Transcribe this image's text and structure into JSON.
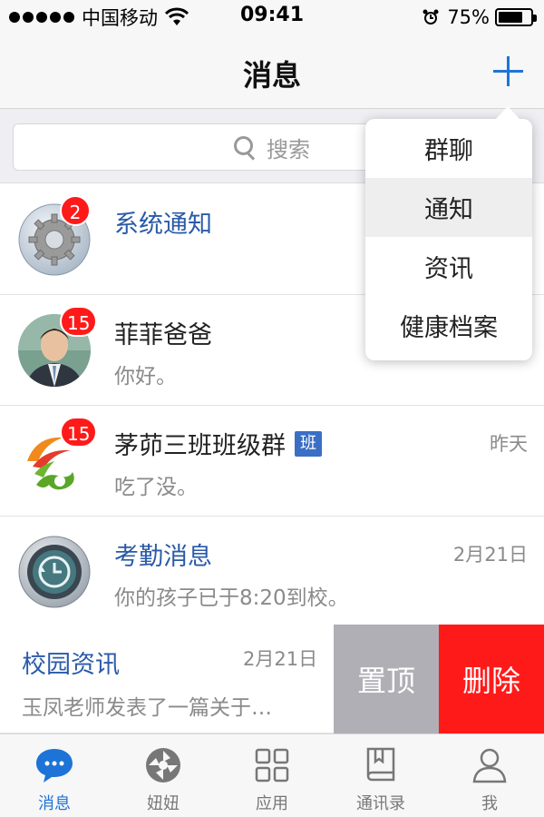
{
  "status_bar": {
    "carrier": "中国移动",
    "time": "09:41",
    "battery_percent": "75%",
    "battery_level": 0.75
  },
  "nav": {
    "title": "消息",
    "add_icon": "plus-icon"
  },
  "search": {
    "placeholder": "搜索"
  },
  "dropdown": {
    "items": [
      "群聊",
      "通知",
      "资讯",
      "健康档案"
    ],
    "highlighted_index": 1
  },
  "messages": [
    {
      "title": "系统通知",
      "subtitle": "",
      "time": "",
      "badge": "2",
      "avatar_icon": "gear-icon",
      "title_color": "#2a5aa8"
    },
    {
      "title": "菲菲爸爸",
      "subtitle": "你好。",
      "time": "",
      "badge": "15",
      "avatar_icon": "person-photo",
      "title_color": "#222222"
    },
    {
      "title": "茅茆三班班级群",
      "tag": "班",
      "subtitle": "吃了没。",
      "time": "昨天",
      "badge": "15",
      "avatar_icon": "class-logo-icon",
      "title_color": "#222222"
    },
    {
      "title": "考勤消息",
      "subtitle": "你的孩子已于8:20到校。",
      "time": "2月21日",
      "badge": "",
      "avatar_icon": "clock-icon",
      "title_color": "#2a5aa8"
    }
  ],
  "swipe_row": {
    "title": "校园资讯",
    "subtitle": "玉凤老师发表了一篇关于…",
    "time": "2月21日",
    "pin_label": "置顶",
    "delete_label": "删除"
  },
  "tabs": [
    {
      "label": "消息",
      "icon": "chat-bubble-icon",
      "active": true
    },
    {
      "label": "妞妞",
      "icon": "camera-aperture-icon",
      "active": false
    },
    {
      "label": "应用",
      "icon": "grid-icon",
      "active": false
    },
    {
      "label": "通讯录",
      "icon": "book-icon",
      "active": false
    },
    {
      "label": "我",
      "icon": "user-icon",
      "active": false
    }
  ],
  "colors": {
    "accent": "#1e74d6",
    "badge": "#ff1a1a",
    "pin": "#b0afb5",
    "delete": "#ff1a1a"
  }
}
